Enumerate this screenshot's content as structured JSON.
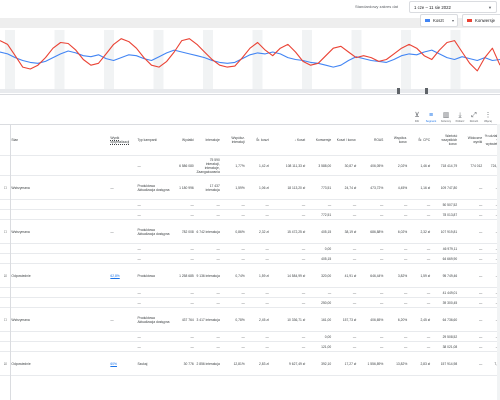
{
  "header": {
    "range_label": "Standardowy zakres dat",
    "range_value": "1 cze – 11 sie 2022",
    "caret": "▼"
  },
  "metrics": [
    {
      "label": "Koszt",
      "color": "#4285f4"
    },
    {
      "label": "Konwersje",
      "color": "#ea4335"
    }
  ],
  "colors": {
    "blue": "#4285f4",
    "red": "#ea4335",
    "accent": "#1a73e8"
  },
  "chart_data": {
    "type": "line",
    "series": [
      {
        "name": "Koszt",
        "color": "#4285f4",
        "values": [
          36,
          34,
          30,
          27,
          25,
          24,
          26,
          30,
          34,
          37,
          35,
          32,
          31,
          33,
          29,
          27,
          30,
          33,
          32,
          29,
          27,
          31,
          35,
          38,
          36,
          34,
          32,
          30,
          27,
          25,
          24,
          25,
          29,
          33,
          35,
          34,
          36,
          34,
          30,
          28,
          27,
          25,
          24,
          22,
          20,
          22,
          27,
          31,
          29,
          27,
          26,
          25,
          28,
          32,
          34,
          33,
          36,
          38,
          34,
          30,
          28,
          31,
          29,
          27,
          30,
          27,
          28
        ]
      },
      {
        "name": "Konwersje",
        "color": "#ea4335",
        "values": [
          48,
          44,
          32,
          20,
          18,
          22,
          30,
          40,
          46,
          45,
          38,
          28,
          22,
          24,
          34,
          44,
          50,
          47,
          40,
          30,
          22,
          20,
          26,
          36,
          48,
          50,
          44,
          36,
          28,
          22,
          20,
          21,
          30,
          40,
          46,
          38,
          32,
          40,
          44,
          36,
          26,
          22,
          24,
          32,
          40,
          42,
          36,
          30,
          32,
          30,
          26,
          28,
          34,
          40,
          44,
          40,
          32,
          28,
          38,
          46,
          48,
          36,
          24,
          16,
          30,
          40,
          22
        ]
      }
    ]
  },
  "toolbar": [
    {
      "label": "Filtr",
      "icon": "⊻"
    },
    {
      "label": "Segment",
      "icon": "≡"
    },
    {
      "label": "Kolumny",
      "icon": "▥"
    },
    {
      "label": "Pobierz",
      "icon": "⤓"
    },
    {
      "label": "Rozwiń",
      "icon": "⤢"
    },
    {
      "label": "Więcej",
      "icon": "⋮"
    }
  ],
  "columns": [
    "",
    "Stan",
    "Wynik optymalizacji",
    "Typ kampanii",
    "Wydatki",
    "Interakcje",
    "Współcz. interakcji",
    "Śr. koszt",
    "↓ Koszt",
    "Konwersje",
    "Koszt / konw.",
    "ROAS",
    "Współcz. konw.",
    "Śr. CPC",
    "Wartość wszystkich konw.",
    "Widoczne wyniki",
    "% udziału w wyświetl."
  ],
  "rows": [
    {
      "cls": "total",
      "cells": [
        "",
        "",
        "",
        "—",
        "6 586 080",
        "75 590 interakcji, interakcje, Zaangażowania",
        "1,77%",
        "1,42 zł",
        "108 111,33 zł",
        "3 588,00",
        "30,87 zł",
        "406,05%",
        "2,02%",
        "1,46 zł",
        "718 414,79",
        "774 012",
        "724,4"
      ]
    },
    {
      "cls": "tall",
      "cells": [
        "☐",
        "Wstrzymana",
        "—",
        "Produktowa Aktualizacja dostępna",
        "1 180 996",
        "17 437 interakcja",
        "1,59%",
        "1,06 zł",
        "18 113,20 zł",
        "773,51",
        "24,74 zł",
        "473,72%",
        "4,45%",
        "1,16 zł",
        "109 747,80",
        "—",
        "—"
      ]
    },
    {
      "cls": "",
      "cells": [
        "",
        "",
        "",
        "—",
        "—",
        "—",
        "—",
        "—",
        "—",
        "—",
        "—",
        "—",
        "—",
        "—",
        "50 507,52",
        "—",
        "—"
      ]
    },
    {
      "cls": "",
      "cells": [
        "",
        "",
        "",
        "—",
        "—",
        "—",
        "—",
        "—",
        "—",
        "772,51",
        "—",
        "—",
        "—",
        "—",
        "78 013,87",
        "—",
        "—"
      ]
    },
    {
      "cls": "tall",
      "cells": [
        "☐",
        "Wstrzymana",
        "—",
        "Produktowa Aktualizacja dostępna",
        "782 008",
        "6 742 interakcja",
        "0,86%",
        "2,32 zł",
        "15 472,25 zł",
        "405,15",
        "38,19 zł",
        "686,88%",
        "6,02%",
        "2,32 zł",
        "107 919,81",
        "—",
        "—"
      ]
    },
    {
      "cls": "",
      "cells": [
        "",
        "",
        "",
        "—",
        "—",
        "—",
        "—",
        "—",
        "—",
        "0,00",
        "—",
        "—",
        "—",
        "—",
        "46 979,11",
        "—",
        "—"
      ]
    },
    {
      "cls": "",
      "cells": [
        "",
        "",
        "",
        "—",
        "—",
        "—",
        "—",
        "—",
        "—",
        "405,15",
        "—",
        "—",
        "—",
        "—",
        "64 669,90",
        "—",
        "—"
      ]
    },
    {
      "cls": "tall",
      "cells": [
        "☑",
        "Odpowiednie",
        "62,8%",
        "Produktowa",
        "1 258 685",
        "9 136 interakcja",
        "0,74%",
        "1,59 zł",
        "14 584,99 zł",
        "320,00",
        "41,91 zł",
        "646,44%",
        "3,82%",
        "1,59 zł",
        "95 749,46",
        "—",
        "—"
      ]
    },
    {
      "cls": "",
      "cells": [
        "",
        "",
        "",
        "—",
        "—",
        "—",
        "—",
        "—",
        "—",
        "—",
        "—",
        "—",
        "—",
        "—",
        "41 449,01",
        "—",
        "—"
      ]
    },
    {
      "cls": "",
      "cells": [
        "",
        "",
        "",
        "—",
        "—",
        "—",
        "—",
        "—",
        "—",
        "250,00",
        "—",
        "—",
        "—",
        "—",
        "39 300,45",
        "—",
        "—"
      ]
    },
    {
      "cls": "tall",
      "cells": [
        "☐",
        "Wstrzymana",
        "—",
        "Produktowa Aktualizacja dostępna",
        "437 764",
        "3 417 interakcja",
        "0,78%",
        "2,45 zł",
        "10 336,71 zł",
        "161,00",
        "157,73 zł",
        "406,65%",
        "6,20%",
        "2,45 zł",
        "64 736,60",
        "—",
        "—"
      ]
    },
    {
      "cls": "",
      "cells": [
        "",
        "",
        "",
        "—",
        "—",
        "—",
        "—",
        "—",
        "—",
        "0,00",
        "—",
        "—",
        "—",
        "—",
        "29 508,52",
        "—",
        "—"
      ]
    },
    {
      "cls": "",
      "cells": [
        "",
        "",
        "",
        "—",
        "—",
        "—",
        "—",
        "—",
        "—",
        "121,00",
        "—",
        "—",
        "—",
        "—",
        "38 021,08",
        "—",
        "—"
      ]
    },
    {
      "cls": "tall",
      "cells": [
        "☑",
        "Odpowiednie",
        "60%",
        "Szukaj",
        "30 776",
        "2 856 interakcja",
        "12,81%",
        "2,83 zł",
        "9 627,49 zł",
        "392,10",
        "17,27 zł",
        "1 556,89%",
        "13,82%",
        "2,83 zł",
        "157 914,98",
        "—",
        "7,9"
      ]
    }
  ]
}
